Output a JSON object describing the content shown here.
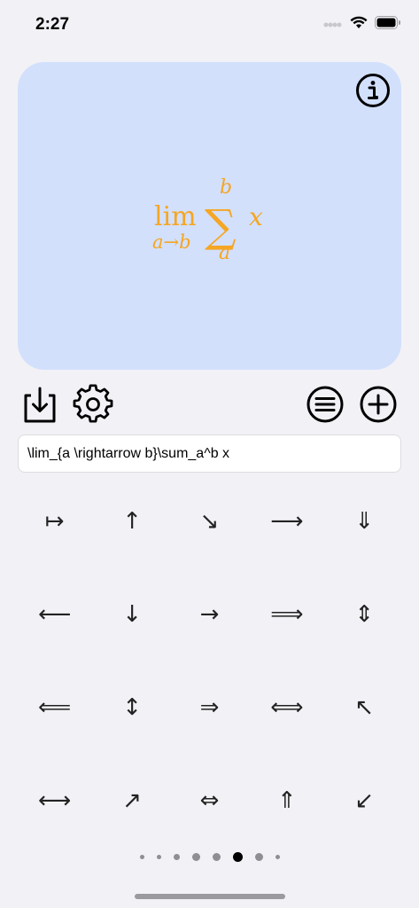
{
  "status_bar": {
    "time": "2:27"
  },
  "preview": {
    "background_color": "#d2e0fc",
    "formula_color": "#f5a623",
    "formula_parts": {
      "lim": "lim",
      "lim_sub": "a→b",
      "sum_symbol": "∑",
      "sum_upper": "b",
      "sum_lower": "a",
      "body": "x"
    },
    "info_icon": "info-circle-icon"
  },
  "toolbar": {
    "left_icons": [
      "download-icon",
      "gear-icon"
    ],
    "right_icons": [
      "list-circle-icon",
      "plus-circle-icon"
    ]
  },
  "input": {
    "value": "\\lim_{a \\rightarrow b}\\sum_a^b x"
  },
  "symbols": [
    "↦",
    "↑",
    "↘",
    "⟶",
    "⇓",
    "⟵",
    "↓",
    "→",
    "⟹",
    "⇕",
    "⟸",
    "↕",
    "⇒",
    "⟺",
    "↖",
    "⟷",
    "↗",
    "⇔",
    "⇑",
    "↙"
  ],
  "pagination": {
    "total": 8,
    "current": 5
  }
}
